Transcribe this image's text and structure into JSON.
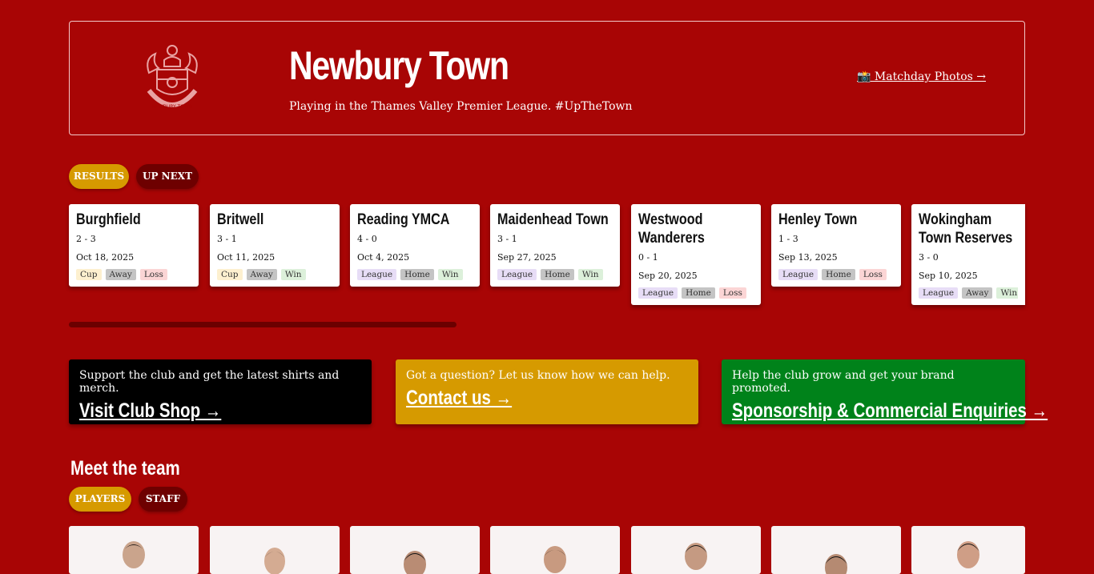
{
  "header": {
    "title": "Newbury Town",
    "tagline": "Playing in the Thames Valley Premier League. #UpTheTown",
    "photos_link": "📸 Matchday Photos →",
    "crest_text": "NEWBURY TOWN",
    "crest_icon": "club-crest"
  },
  "fixtures_tabs": [
    {
      "label": "RESULTS",
      "active": true
    },
    {
      "label": "UP NEXT",
      "active": false
    }
  ],
  "results": [
    {
      "team": "Burghfield",
      "score": "2 - 3",
      "date": "Oct 18, 2025",
      "tags": [
        {
          "label": "Cup",
          "kind": "cup"
        },
        {
          "label": "Away",
          "kind": "away"
        },
        {
          "label": "Loss",
          "kind": "loss"
        }
      ]
    },
    {
      "team": "Britwell",
      "score": "3 - 1",
      "date": "Oct 11, 2025",
      "tags": [
        {
          "label": "Cup",
          "kind": "cup"
        },
        {
          "label": "Away",
          "kind": "away"
        },
        {
          "label": "Win",
          "kind": "win"
        }
      ]
    },
    {
      "team": "Reading YMCA",
      "score": "4 - 0",
      "date": "Oct 4, 2025",
      "tags": [
        {
          "label": "League",
          "kind": "league"
        },
        {
          "label": "Home",
          "kind": "home"
        },
        {
          "label": "Win",
          "kind": "win"
        }
      ]
    },
    {
      "team": "Maidenhead Town",
      "score": "3 - 1",
      "date": "Sep 27, 2025",
      "tags": [
        {
          "label": "League",
          "kind": "league"
        },
        {
          "label": "Home",
          "kind": "home"
        },
        {
          "label": "Win",
          "kind": "win"
        }
      ]
    },
    {
      "team": "Westwood Wanderers",
      "score": "0 - 1",
      "date": "Sep 20, 2025",
      "tags": [
        {
          "label": "League",
          "kind": "league"
        },
        {
          "label": "Home",
          "kind": "home"
        },
        {
          "label": "Loss",
          "kind": "loss"
        }
      ]
    },
    {
      "team": "Henley Town",
      "score": "1 - 3",
      "date": "Sep 13, 2025",
      "tags": [
        {
          "label": "League",
          "kind": "league"
        },
        {
          "label": "Home",
          "kind": "home"
        },
        {
          "label": "Loss",
          "kind": "loss"
        }
      ]
    },
    {
      "team": "Wokingham Town Reserves",
      "score": "3 - 0",
      "date": "Sep 10, 2025",
      "tags": [
        {
          "label": "League",
          "kind": "league"
        },
        {
          "label": "Away",
          "kind": "away"
        },
        {
          "label": "Win",
          "kind": "win"
        }
      ]
    }
  ],
  "ctas": [
    {
      "text": "Support the club and get the latest shirts and merch.",
      "link": "Visit Club Shop →",
      "color": "#000000"
    },
    {
      "text": "Got a question? Let us know how we can help.",
      "link": "Contact us →",
      "color": "#d69a00"
    },
    {
      "text": "Help the club grow and get your brand promoted.",
      "link": "Sponsorship & Commercial Enquiries →",
      "color": "#00821a"
    }
  ],
  "team_section": {
    "title": "Meet the team",
    "tabs": [
      {
        "label": "PLAYERS",
        "active": true
      },
      {
        "label": "STAFF",
        "active": false
      }
    ],
    "player_count_visible": 7
  },
  "colors": {
    "background": "#a80505",
    "accent": "#d69a00",
    "tab_inactive": "#6e0000"
  }
}
